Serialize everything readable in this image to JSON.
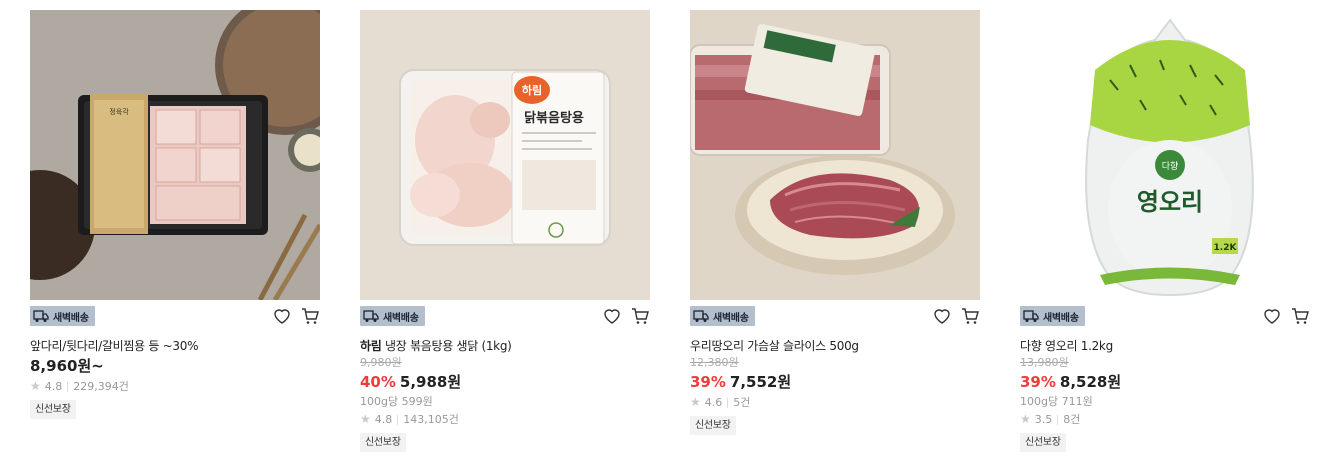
{
  "products": [
    {
      "badge": "새벽배송",
      "name": "앞다리/뒷다리/갈비찜용 등 ~30%",
      "price": "8,960원~",
      "rating": "4.8",
      "reviews": "229,394건",
      "tag": "신선보장",
      "image_labels": {
        "package": "정육각"
      }
    },
    {
      "badge": "새벽배송",
      "brand": "하림",
      "name": "냉장 볶음탕용 생닭 (1kg)",
      "original_price": "9,980원",
      "discount": "40%",
      "price": "5,988원",
      "unit_price": "100g당 599원",
      "rating": "4.8",
      "reviews": "143,105건",
      "tag": "신선보장",
      "image_labels": {
        "brand": "하림",
        "product": "닭볶음탕용"
      }
    },
    {
      "badge": "새벽배송",
      "name": "우리땅오리 가슴살 슬라이스 500g",
      "original_price": "12,380원",
      "discount": "39%",
      "price": "7,552원",
      "rating": "4.6",
      "reviews": "5건",
      "tag": "신선보장"
    },
    {
      "badge": "새벽배송",
      "name": "다향 영오리 1.2kg",
      "original_price": "13,980원",
      "discount": "39%",
      "price": "8,528원",
      "unit_price": "100g당 711원",
      "rating": "3.5",
      "reviews": "8건",
      "tag": "신선보장",
      "image_labels": {
        "brand": "다향",
        "product": "영오리",
        "weight": "1.2K"
      }
    }
  ],
  "colors": {
    "discount": "#f23b3b",
    "badge_bg": "#b3bfcc",
    "tag_bg": "#f2f2f2"
  },
  "icons": [
    "truck-icon",
    "heart-icon",
    "cart-icon",
    "star-icon"
  ]
}
